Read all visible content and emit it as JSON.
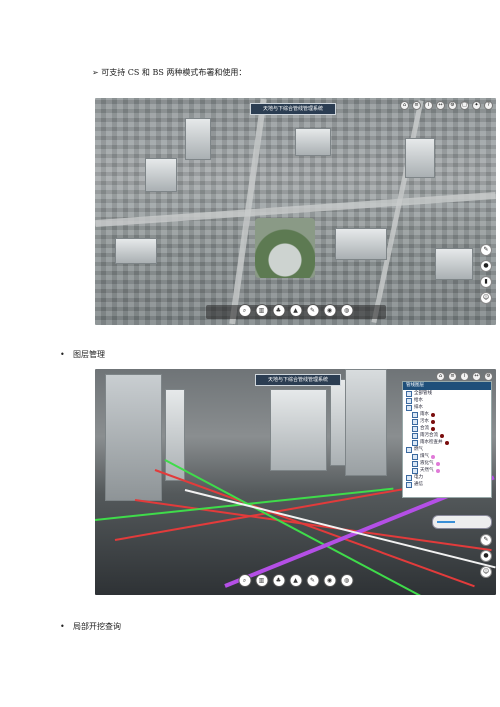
{
  "intro_line": "➢ 可支持 CS 和 BS 两种模式布署和使用：",
  "bullet_1": "图层管理",
  "bullet_2": "局部开挖查询",
  "bullet_symbol": "•",
  "app_title": "天地与下综合管线管理系统",
  "layer_panel": {
    "title": "管线图层",
    "items": [
      {
        "label": "全部管线",
        "indent": 0,
        "color": ""
      },
      {
        "label": "给水",
        "indent": 0,
        "color": ""
      },
      {
        "label": "排水",
        "indent": 0,
        "color": ""
      },
      {
        "label": "雨水",
        "indent": 1,
        "color": "#7a0d0d"
      },
      {
        "label": "污水",
        "indent": 1,
        "color": "#7a0d0d"
      },
      {
        "label": "合流",
        "indent": 1,
        "color": "#7a0d0d"
      },
      {
        "label": "雨污合流",
        "indent": 1,
        "color": "#7a0d0d"
      },
      {
        "label": "雨水检查井",
        "indent": 1,
        "color": "#7a0d0d"
      },
      {
        "label": "燃气",
        "indent": 0,
        "color": ""
      },
      {
        "label": "煤气",
        "indent": 1,
        "color": "#e07ad8"
      },
      {
        "label": "液化气",
        "indent": 1,
        "color": "#e07ad8"
      },
      {
        "label": "天然气",
        "indent": 1,
        "color": "#e07ad8"
      },
      {
        "label": "电力",
        "indent": 0,
        "color": ""
      },
      {
        "label": "通信",
        "indent": 0,
        "color": ""
      }
    ]
  },
  "colors": {
    "title_bar": "#2b3d52",
    "pipe_red": "#e23b3b",
    "pipe_green": "#3fdc4a",
    "pipe_purple": "#b44fe6",
    "pipe_white": "#f2f2f2"
  },
  "icons": {
    "top": [
      "home-icon",
      "layers-icon",
      "info-icon",
      "measure-icon",
      "settings-icon",
      "fullscreen-icon",
      "compass-icon",
      "help-icon"
    ],
    "toolbar": [
      "zoom-icon",
      "chart-icon",
      "tree-icon",
      "building-icon",
      "pen-icon",
      "camera-icon",
      "globe-icon"
    ],
    "side": [
      "edit-icon",
      "pin-icon",
      "cylinder-icon",
      "person-icon"
    ]
  },
  "slider_level": 0.35
}
